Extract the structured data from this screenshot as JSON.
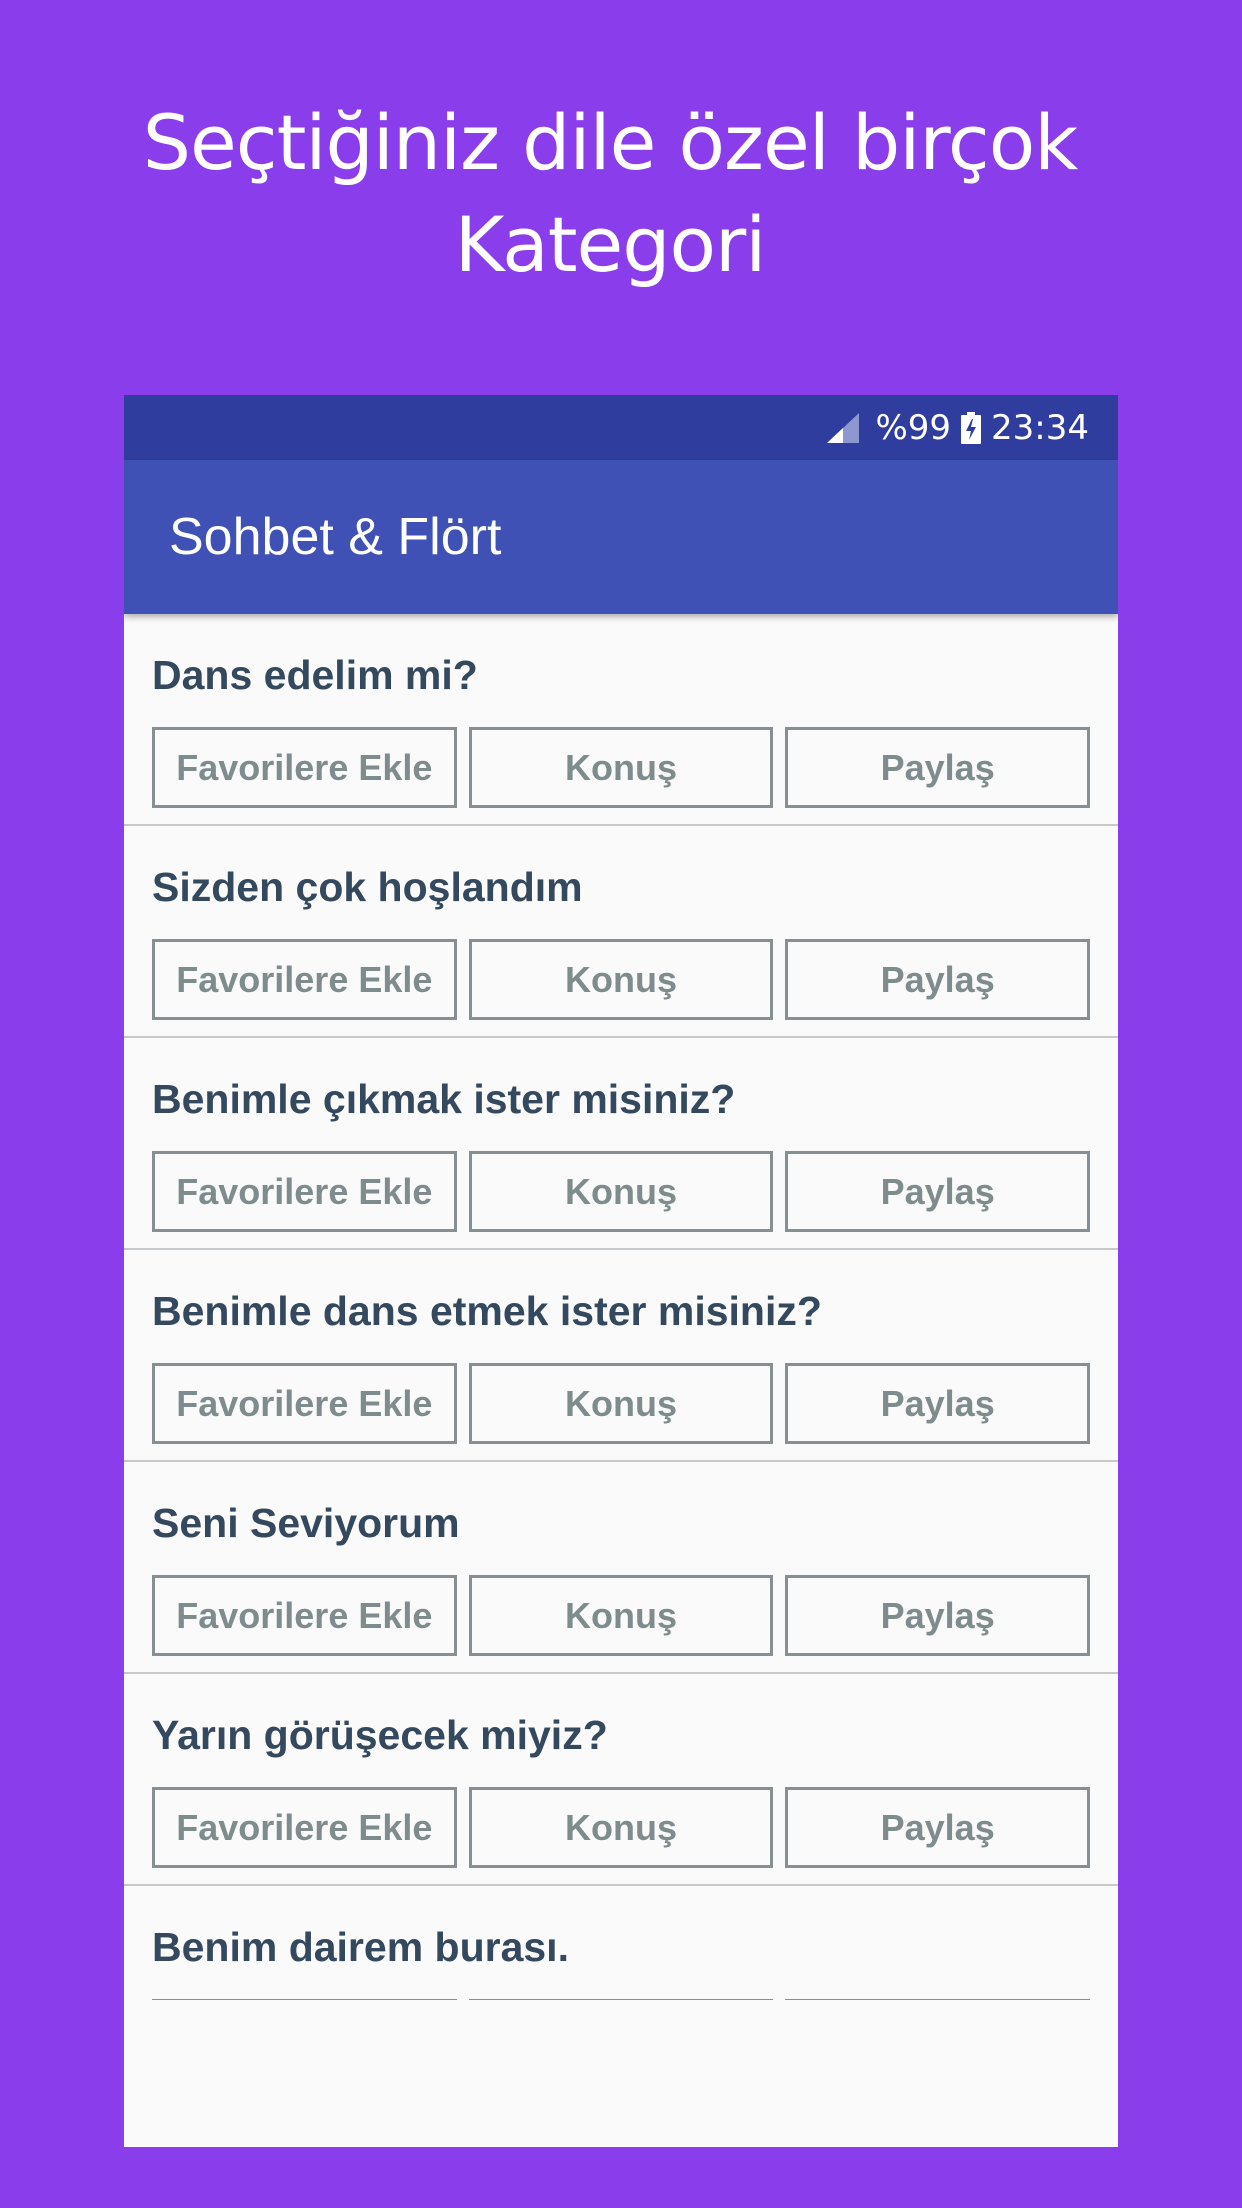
{
  "promo": {
    "title_line1": "Seçtiğiniz dile özel birçok",
    "title_line2": "Kategori"
  },
  "status_bar": {
    "battery": "%99",
    "time": "23:34",
    "icons": [
      "signal-icon",
      "battery-charging-icon"
    ]
  },
  "app_bar": {
    "title": "Sohbet & Flört"
  },
  "buttons": {
    "favorite": "Favorilere Ekle",
    "speak": "Konuş",
    "share": "Paylaş"
  },
  "phrases": [
    "Dans edelim mi?",
    "Sizden çok hoşlandım",
    "Benimle çıkmak ister misiniz?",
    "Benimle dans etmek ister misiniz?",
    "Seni Seviyorum",
    "Yarın görüşecek miyiz?",
    "Benim dairem burası."
  ],
  "colors": {
    "background": "#8a3dea",
    "status_bar": "#2f3e9e",
    "app_bar": "#3f51b5",
    "phrase_text": "#34495e",
    "button_text": "#7f8c8d"
  }
}
